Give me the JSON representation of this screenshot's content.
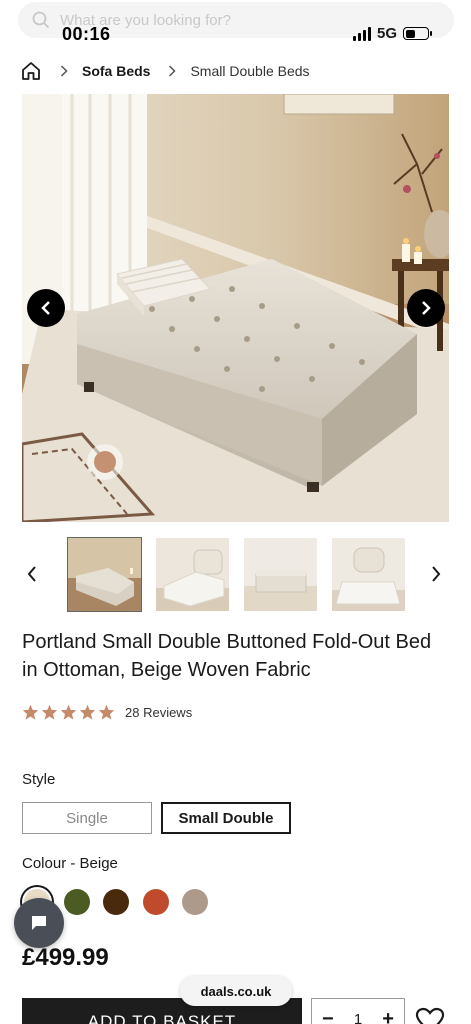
{
  "status_bar": {
    "time": "00:16",
    "network": "5G"
  },
  "search": {
    "placeholder": "What are you looking for?"
  },
  "breadcrumb": {
    "home_icon": "home-icon",
    "items": [
      {
        "label": "Sofa Beds"
      },
      {
        "label": "Small Double Beds"
      }
    ]
  },
  "gallery": {
    "prev_icon": "chevron-left-icon",
    "next_icon": "chevron-right-icon",
    "thumbnail_count": 4
  },
  "product": {
    "title": "Portland Small Double Buttoned Fold-Out Bed in Ottoman, Beige Woven Fabric",
    "rating": 5,
    "reviews_label": "28 Reviews",
    "style_label": "Style",
    "styles": [
      "Single",
      "Small Double"
    ],
    "selected_style": "Small Double",
    "colour_label": "Colour - Beige",
    "colours": [
      {
        "name": "Beige",
        "hex": "#e8dcc6"
      },
      {
        "name": "Green",
        "hex": "#4c5a24"
      },
      {
        "name": "Brown",
        "hex": "#4a2a0c"
      },
      {
        "name": "Rust",
        "hex": "#bf4b2c"
      },
      {
        "name": "Taupe",
        "hex": "#ad9a8a"
      }
    ],
    "selected_colour": "Beige",
    "price": "£499.99"
  },
  "actions": {
    "add_to_basket": "ADD TO BASKET",
    "quantity": "1",
    "minus": "−",
    "plus": "+"
  },
  "browser": {
    "url": "daals.co.uk"
  },
  "colors": {
    "accent_star": "#c48a6a",
    "button_dark": "#1d1d1d"
  }
}
